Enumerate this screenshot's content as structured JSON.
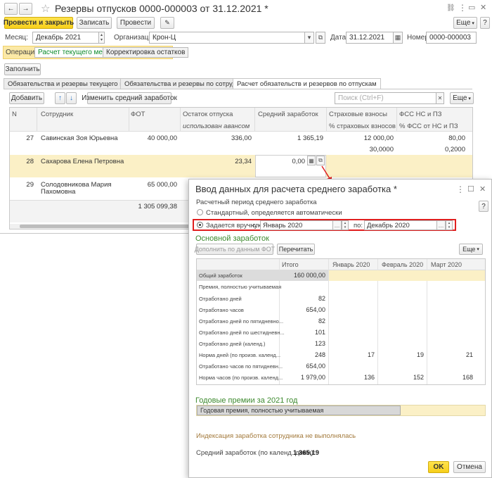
{
  "window": {
    "title": "Резервы отпусков 0000-000003 от 31.12.2021 *",
    "star_glyph": "☆",
    "nav_back": "←",
    "nav_forward": "→",
    "link_glyph": "🔗",
    "more_glyph": "⋮",
    "restore_glyph": "▭",
    "close_glyph": "✕"
  },
  "toolbar": {
    "post_close": "Провести и закрыть",
    "save": "Записать",
    "post": "Провести",
    "attach_glyph": "📎",
    "more": "Еще",
    "help": "?"
  },
  "header": {
    "month_label": "Месяц:",
    "month_value": "Декабрь 2021",
    "org_label": "Организация:",
    "org_value": "Крон-Ц",
    "date_label": "Дата:",
    "date_value": "31.12.2021",
    "number_label": "Номер:",
    "number_value": "0000-000003",
    "operation_label": "Операция:",
    "op_current": "Расчет текущего месяца",
    "op_adjust": "Корректировка остатков",
    "fill": "Заполнить"
  },
  "tabs": [
    {
      "label": "Обязательства и резервы текущего месяца"
    },
    {
      "label": "Обязательства и резервы по сотрудникам"
    },
    {
      "label": "Расчет обязательств и резервов по отпускам"
    }
  ],
  "grid_toolbar": {
    "add": "Добавить",
    "up": "↑",
    "down": "↓",
    "change_avg": "Изменить средний заработок",
    "search_placeholder": "Поиск (Ctrl+F)",
    "more": "Еще"
  },
  "grid": {
    "headers": {
      "n": "N",
      "employee": "Сотрудник",
      "fot": "ФОТ",
      "vacation_rest": "Остаток отпуска",
      "vacation_used": "использован авансом",
      "avg": "Средний заработок",
      "ins": "Страховые взносы",
      "ins_pct": "% страховых взносов",
      "fss": "ФСС НС и ПЗ",
      "fss_pct": "% ФСС от НС и ПЗ"
    },
    "rows": [
      {
        "n": "27",
        "employee": "Савинская Зоя Юрьевна",
        "employee2": "",
        "fot": "40 000,00",
        "rest": "336,00",
        "avg": "1 365,19",
        "ins": "12 000,00",
        "ins_pct": "30,0000",
        "fss": "80,00",
        "fss_pct": "0,2000"
      },
      {
        "n": "28",
        "employee": "Сахарова Елена Петровна",
        "employee2": "",
        "fot": "",
        "rest": "23,34",
        "avg": "0,00",
        "ins": "",
        "ins_pct": "",
        "fss": "",
        "fss_pct": ""
      },
      {
        "n": "29",
        "employee": "Солодовникова Мария",
        "employee2": "Пахомовна",
        "fot": "65 000,00",
        "rest": "",
        "avg": "",
        "ins": "",
        "ins_pct": "",
        "fss": "",
        "fss_pct": ""
      }
    ],
    "total_fot": "1 305 099,38"
  },
  "dialog": {
    "title": "Ввод данных для расчета среднего заработка *",
    "more_glyph": "⋮",
    "max_glyph": "☐",
    "close_glyph": "✕",
    "period_label": "Расчетный период среднего заработка",
    "opt_standard": "Стандартный, определяется автоматически",
    "opt_manual": "Задается вручную",
    "from_label": "с:",
    "from_value": "Январь 2020",
    "to_label": "по:",
    "to_value": "Декабрь 2020",
    "main_earnings": "Основной заработок",
    "fill_by_fot": "Дополнить по данным ФОТ",
    "reread": "Перечитать",
    "more": "Еще",
    "table_headers": [
      "Итого",
      "Январь 2020",
      "Февраль 2020",
      "Март 2020"
    ],
    "table_rows": [
      {
        "label": "Общий заработок",
        "total": "160 000,00",
        "m1": "",
        "m2": "",
        "m3": ""
      },
      {
        "label": "Премия, полностью учитываемая",
        "total": "",
        "m1": "",
        "m2": "",
        "m3": ""
      },
      {
        "label": "Отработано дней",
        "total": "82",
        "m1": "",
        "m2": "",
        "m3": ""
      },
      {
        "label": "Отработано часов",
        "total": "654,00",
        "m1": "",
        "m2": "",
        "m3": ""
      },
      {
        "label": "Отработано дней по пятидневно...",
        "total": "82",
        "m1": "",
        "m2": "",
        "m3": ""
      },
      {
        "label": "Отработано дней по шестидневн...",
        "total": "101",
        "m1": "",
        "m2": "",
        "m3": ""
      },
      {
        "label": "Отработано дней (календ.)",
        "total": "123",
        "m1": "",
        "m2": "",
        "m3": ""
      },
      {
        "label": "Норма дней (по произв. календ...",
        "total": "248",
        "m1": "17",
        "m2": "19",
        "m3": "21"
      },
      {
        "label": "Отработано часов по пятидневн...",
        "total": "654,00",
        "m1": "",
        "m2": "",
        "m3": ""
      },
      {
        "label": "Норма часов (по произв. календ...",
        "total": "1 979,00",
        "m1": "136",
        "m2": "152",
        "m3": "168"
      }
    ],
    "annual_bonus_title": "Годовые премии за 2021 год",
    "annual_bonus_row": "Годовая премия, полностью учитываемая",
    "indexation": "Индексация заработка сотрудника не выполнялась",
    "avg_label": "Средний заработок (по календ. дням):",
    "avg_value": "1 365,19",
    "ok": "OK",
    "cancel": "Отмена"
  },
  "colors": {
    "accent_yellow": "#f7d43a",
    "highlight_row": "#fbf0c6",
    "section_green": "#3d8a2e",
    "red_frame": "#e02020"
  }
}
